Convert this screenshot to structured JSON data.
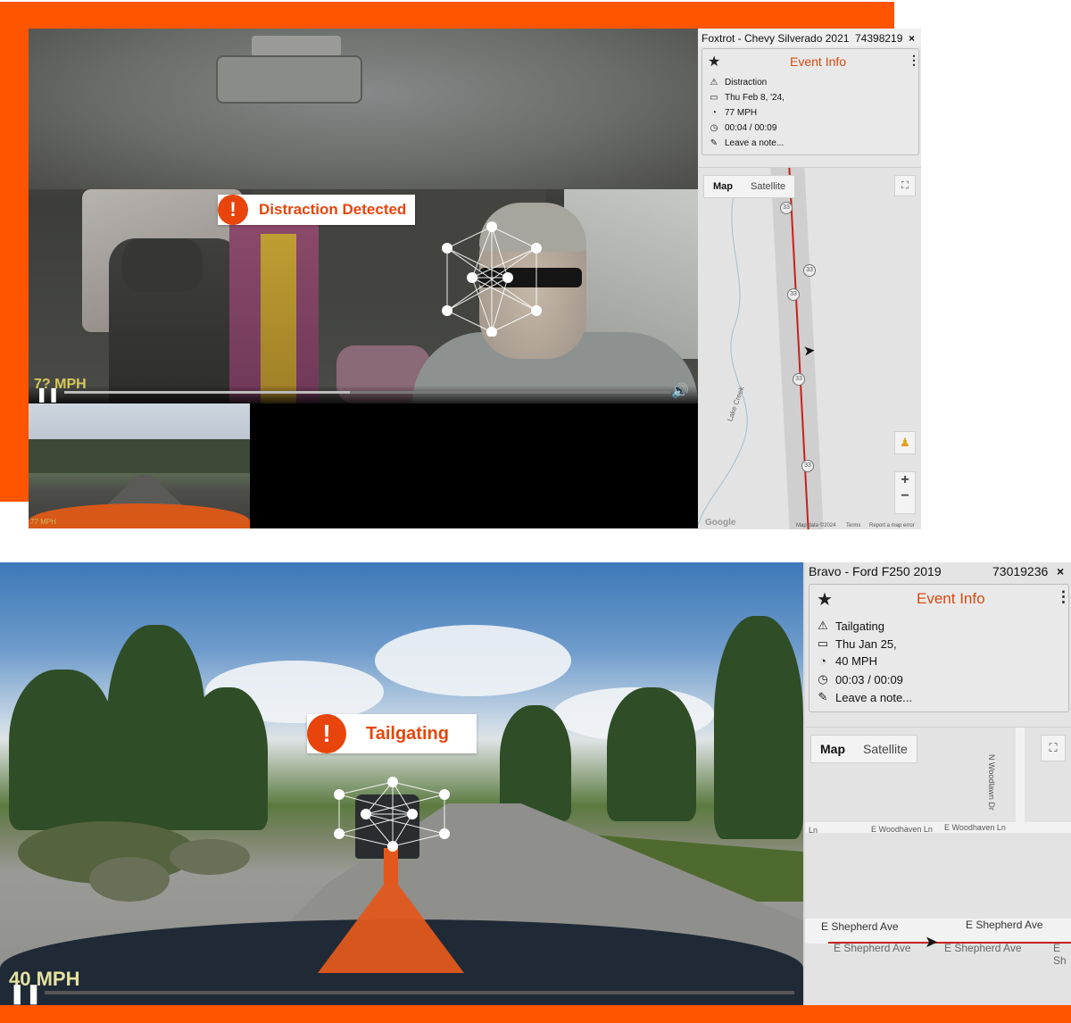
{
  "panel1": {
    "vehicle": "Foxtrot - Chevy Silverado 2021",
    "vehicle_id": "74398219",
    "close": "×",
    "event_title": "Event Info",
    "event_type": "Distraction",
    "date": "Thu Feb 8, '24,",
    "speed_value": "77 MPH",
    "time": "00:04 / 00:09",
    "note_placeholder": "Leave a note...",
    "alert_text": "Distraction Detected",
    "overlay_speed": "7? MPH",
    "map_tab": "Map",
    "satellite_tab": "Satellite",
    "road_label": "Lake Creek",
    "shield": "33",
    "map_footer": {
      "google": "Google",
      "data": "Map data ©2024",
      "terms": "Terms",
      "report": "Report a map error"
    },
    "thumb_speed": "7? MPH",
    "playback_progress": 0.47
  },
  "panel2": {
    "vehicle": "Bravo - Ford F250 2019",
    "vehicle_id": "73019236",
    "close": "×",
    "event_title": "Event Info",
    "event_type": "Tailgating",
    "date": "Thu Jan 25,",
    "speed_value": "40 MPH",
    "time": "00:03 / 00:09",
    "note_placeholder": "Leave a note...",
    "alert_text": "Tailgating",
    "overlay_speed": "40 MPH",
    "map_tab": "Map",
    "satellite_tab": "Satellite",
    "streets": {
      "woodhaven_left": "Ln",
      "woodhaven_1": "E Woodhaven Ln",
      "woodhaven_2": "E Woodhaven Ln",
      "woodlawn": "N Woodlawn Dr",
      "shepherd_1": "E Shepherd Ave",
      "shepherd_2": "E Shepherd Ave",
      "shepherd_3": "E Shepherd Ave",
      "shepherd_4": "E Shepherd Ave",
      "shepherd_5": "E Sh"
    },
    "playback_progress": 0.0
  },
  "colors": {
    "accent": "#ff5400",
    "alert": "#e8450c",
    "route": "#c8201a"
  },
  "icons": [
    "star-icon",
    "kebab-icon",
    "warning-icon",
    "calendar-icon",
    "speedometer-icon",
    "clock-icon",
    "pencil-icon",
    "fullscreen-icon",
    "pegman-icon",
    "zoom-in-icon",
    "zoom-out-icon",
    "pause-icon",
    "volume-icon",
    "close-icon",
    "alert-icon"
  ]
}
